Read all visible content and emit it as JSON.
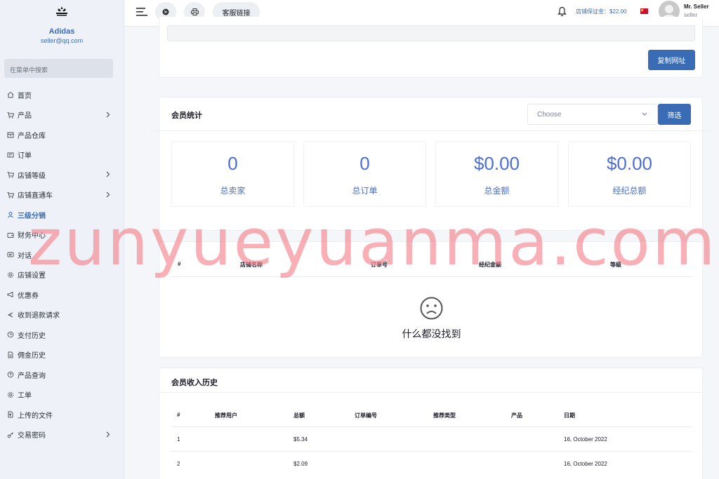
{
  "brand": {
    "name": "Adidas",
    "email": "seller@qq.com"
  },
  "search": {
    "placeholder": "在菜单中搜索"
  },
  "menu": [
    {
      "label": "首页",
      "icon": "home-icon",
      "chevron": false,
      "active": false
    },
    {
      "label": "产品",
      "icon": "cart-icon",
      "chevron": true,
      "active": false
    },
    {
      "label": "产品仓库",
      "icon": "archive-icon",
      "chevron": false,
      "active": false
    },
    {
      "label": "订单",
      "icon": "invoice-icon",
      "chevron": false,
      "active": false
    },
    {
      "label": "店铺等级",
      "icon": "cart-icon",
      "chevron": true,
      "active": false
    },
    {
      "label": "店铺直通车",
      "icon": "cart-icon",
      "chevron": true,
      "active": false
    },
    {
      "label": "三级分销",
      "icon": "user-icon",
      "chevron": false,
      "active": true
    },
    {
      "label": "财务中心",
      "icon": "wallet-icon",
      "chevron": false,
      "active": false
    },
    {
      "label": "对话",
      "icon": "chat-icon",
      "chevron": false,
      "active": false
    },
    {
      "label": "店铺设置",
      "icon": "gear-icon",
      "chevron": false,
      "active": false
    },
    {
      "label": "优惠券",
      "icon": "megaphone-icon",
      "chevron": false,
      "active": false
    },
    {
      "label": "收到退款请求",
      "icon": "refund-icon",
      "chevron": false,
      "active": false
    },
    {
      "label": "支付历史",
      "icon": "history-icon",
      "chevron": false,
      "active": false
    },
    {
      "label": "佣金历史",
      "icon": "document-icon",
      "chevron": false,
      "active": false
    },
    {
      "label": "产品查询",
      "icon": "question-icon",
      "chevron": false,
      "active": false
    },
    {
      "label": "工单",
      "icon": "gear-icon",
      "chevron": false,
      "active": false
    },
    {
      "label": "上传的文件",
      "icon": "folder-icon",
      "chevron": false,
      "active": false
    },
    {
      "label": "交易密码",
      "icon": "key-icon",
      "chevron": true,
      "active": false
    }
  ],
  "topbar": {
    "service_link": "客服链接",
    "deposit": "店铺保证金：$22.00",
    "user_name": "Mr. Seller",
    "user_role": "seller"
  },
  "copy_card": {
    "copy_button": "复制网址"
  },
  "stats_card": {
    "title": "会员统计",
    "select_value": "Choose",
    "filter_button": "筛选",
    "stats": [
      {
        "value": "0",
        "label": "总卖家"
      },
      {
        "value": "0",
        "label": "总订单"
      },
      {
        "value": "$0.00",
        "label": "总金额"
      },
      {
        "value": "$0.00",
        "label": "经纪总额"
      }
    ]
  },
  "orders_card": {
    "headers": [
      "#",
      "店铺名称",
      "订单号",
      "经纪金额",
      "等级"
    ],
    "empty_text": "什么都没找到"
  },
  "income_card": {
    "title": "会员收入历史",
    "headers": [
      "#",
      "推荐用户",
      "总额",
      "订单编号",
      "推荐类型",
      "产品",
      "日期"
    ],
    "rows": [
      {
        "num": "1",
        "amount": "$5.34",
        "date": "16, October 2022"
      },
      {
        "num": "2",
        "amount": "$2.09",
        "date": "16, October 2022"
      }
    ]
  },
  "watermark": "zunyueyuanma.com"
}
